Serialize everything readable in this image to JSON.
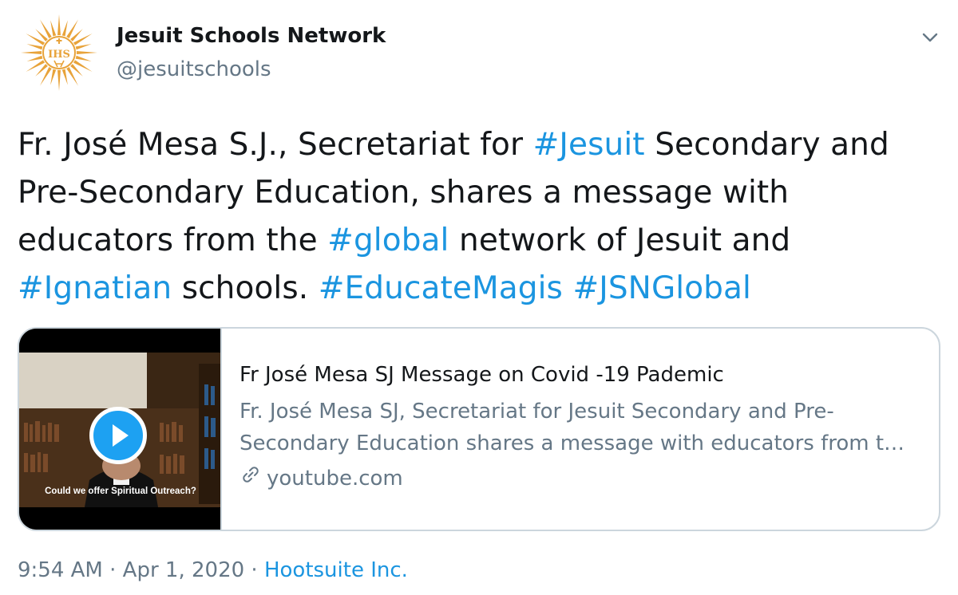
{
  "account": {
    "name": "Jesuit Schools Network",
    "handle": "@jesuitschools",
    "avatar_icon": "ihs-sunburst-logo",
    "avatar_text": "IHS"
  },
  "tweet": {
    "lines": [
      [
        {
          "text": "Fr. José Mesa S.J., Secretariat for ",
          "link": false
        },
        {
          "text": "#Jesuit",
          "link": true
        },
        {
          "text": " Secondary and",
          "link": false
        }
      ],
      [
        {
          "text": "Pre-Secondary Education, shares a message with",
          "link": false
        }
      ],
      [
        {
          "text": "educators from the ",
          "link": false
        },
        {
          "text": "#global",
          "link": true
        },
        {
          "text": " network of Jesuit and",
          "link": false
        }
      ],
      [
        {
          "text": "#Ignatian",
          "link": true
        },
        {
          "text": " schools. ",
          "link": false
        },
        {
          "text": "#EducateMagis",
          "link": true
        },
        {
          "text": " ",
          "link": false
        },
        {
          "text": "#JSNGlobal",
          "link": true
        }
      ]
    ]
  },
  "card": {
    "title": "Fr José Mesa SJ Message on Covid -19 Pademic",
    "description_lines": [
      "Fr. José Mesa SJ, Secretariat for Jesuit Secondary and Pre-",
      "Secondary Education shares a message with educators from t…"
    ],
    "domain": "youtube.com",
    "domain_icon": "link-icon",
    "thumbnail_caption": "Could we offer Spiritual Outreach?",
    "play_icon": "play-icon"
  },
  "meta": {
    "time": "9:54 AM",
    "separator": "·",
    "date": "Apr 1, 2020",
    "source": "Hootsuite Inc."
  },
  "colors": {
    "link": "#1b95e0",
    "secondary_text": "#657786",
    "primary_text": "#14171a",
    "border": "#ccd6dd",
    "logo": "#e8a33a"
  }
}
